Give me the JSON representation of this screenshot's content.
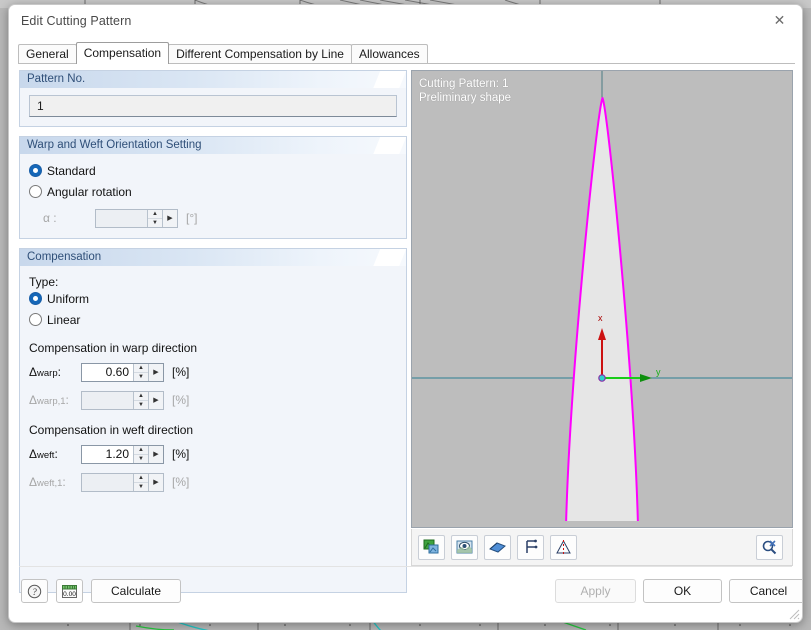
{
  "window": {
    "title": "Edit Cutting Pattern",
    "close_icon": "close-icon"
  },
  "tabs": [
    {
      "label": "General",
      "active": false
    },
    {
      "label": "Compensation",
      "active": true
    },
    {
      "label": "Different Compensation by Line",
      "active": false
    },
    {
      "label": "Allowances",
      "active": false
    }
  ],
  "pattern_no": {
    "group_title": "Pattern No.",
    "value": "1"
  },
  "orientation": {
    "group_title": "Warp and Weft Orientation Setting",
    "options": [
      {
        "label": "Standard",
        "selected": true
      },
      {
        "label": "Angular rotation",
        "selected": false
      }
    ],
    "alpha": {
      "label": "α :",
      "value": "",
      "unit": "[°]",
      "enabled": false
    }
  },
  "compensation": {
    "group_title": "Compensation",
    "type_label": "Type:",
    "type_options": [
      {
        "label": "Uniform",
        "selected": true
      },
      {
        "label": "Linear",
        "selected": false
      }
    ],
    "warp": {
      "section_label": "Compensation in warp direction",
      "primary": {
        "label_main": "Δ",
        "label_sub": "warp",
        "label_colon": " :",
        "value": "0.60",
        "unit": "[%]",
        "enabled": true
      },
      "secondary": {
        "label_main": "Δ",
        "label_sub": "warp,1",
        "label_colon": " :",
        "value": "",
        "unit": "[%]",
        "enabled": false
      }
    },
    "weft": {
      "section_label": "Compensation in weft direction",
      "primary": {
        "label_main": "Δ",
        "label_sub": "weft",
        "label_colon": " :",
        "value": "1.20",
        "unit": "[%]",
        "enabled": true
      },
      "secondary": {
        "label_main": "Δ",
        "label_sub": "weft,1",
        "label_colon": " :",
        "value": "",
        "unit": "[%]",
        "enabled": false
      }
    }
  },
  "viewport": {
    "caption_line1": "Cutting Pattern: 1",
    "caption_line2": "Preliminary shape",
    "caption": "Cutting Pattern: 1\nPreliminary shape",
    "background_color": "#bdbdbd",
    "shape_outline_color": "#ff00ff",
    "shape_fill_color": "#e6e6e6",
    "axis_x_color": "#cc0000",
    "axis_y_color": "#00cc00",
    "axis_x_label": "x",
    "axis_y_label": "y",
    "guide_line_color": "#3d7d88",
    "toolbar_buttons": [
      {
        "icon": "render-mode-icon"
      },
      {
        "icon": "view-preview-icon"
      },
      {
        "icon": "surface-icon"
      },
      {
        "icon": "axes-icon"
      },
      {
        "icon": "mirror-icon"
      }
    ],
    "zoom_button": {
      "icon": "zoom-reset-icon"
    }
  },
  "footer": {
    "help_button": {
      "icon": "help-icon",
      "label": "?"
    },
    "units_button": {
      "icon": "units-icon",
      "label": "0.00"
    },
    "calculate_label": "Calculate",
    "apply_label": "Apply",
    "apply_enabled": false,
    "ok_label": "OK",
    "cancel_label": "Cancel"
  }
}
